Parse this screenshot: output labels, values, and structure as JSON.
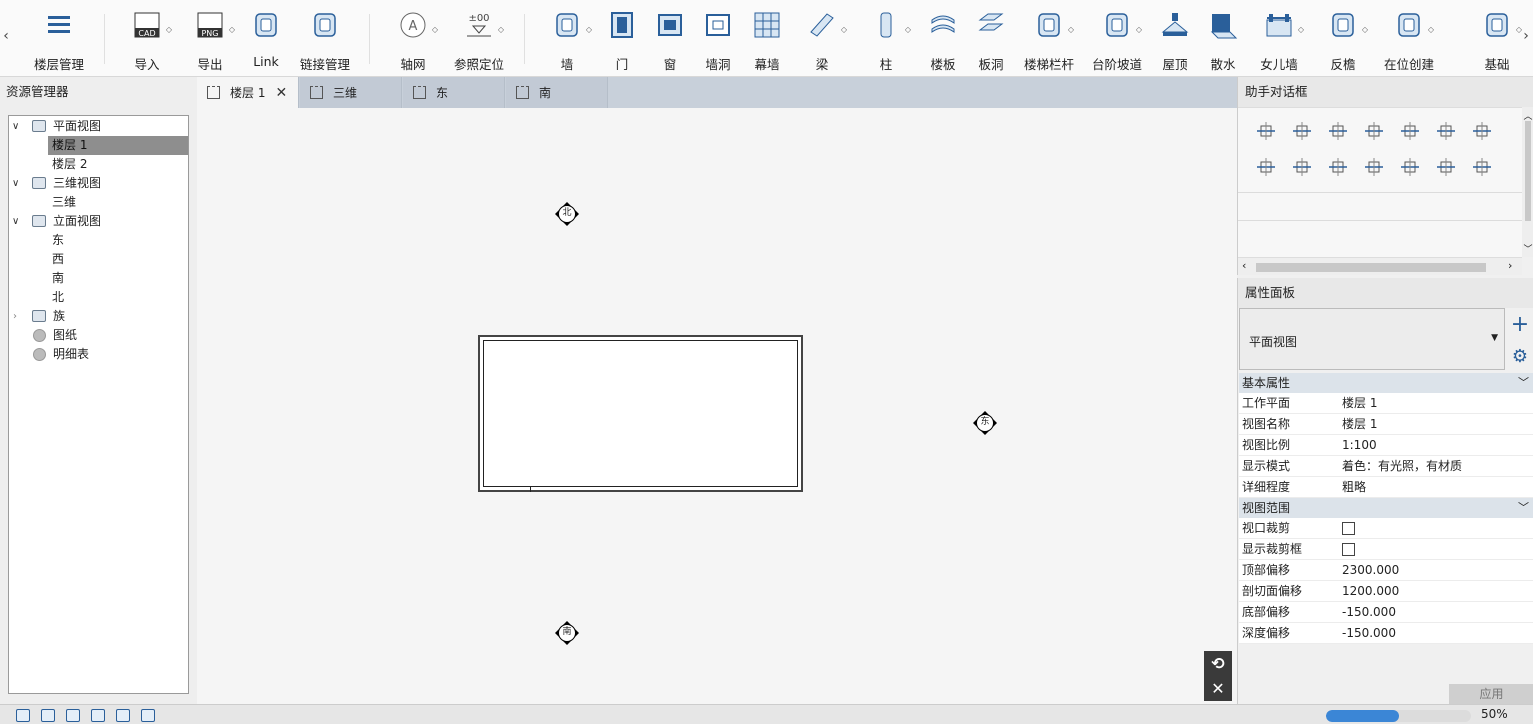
{
  "ribbon": {
    "tools": [
      {
        "id": "floor-mgmt",
        "label": "楼层管理",
        "icon": "floor-levels-icon",
        "dropdown": false
      },
      {
        "id": "import",
        "label": "导入",
        "icon": "cad-import-icon",
        "dropdown": true
      },
      {
        "id": "export",
        "label": "导出",
        "icon": "png-export-icon",
        "dropdown": true
      },
      {
        "id": "link",
        "label": "Link",
        "icon": "link-building-icon",
        "dropdown": false
      },
      {
        "id": "link-mgmt",
        "label": "链接管理",
        "icon": "link-manage-icon",
        "dropdown": false
      },
      {
        "id": "grid",
        "label": "轴网",
        "icon": "axis-grid-icon",
        "dropdown": true
      },
      {
        "id": "ref-level",
        "label": "参照定位",
        "icon": "reference-level-icon",
        "dropdown": true
      },
      {
        "id": "wall",
        "label": "墙",
        "icon": "wall-icon",
        "dropdown": true
      },
      {
        "id": "door",
        "label": "门",
        "icon": "door-icon",
        "dropdown": false
      },
      {
        "id": "window",
        "label": "窗",
        "icon": "window-icon",
        "dropdown": false
      },
      {
        "id": "wall-opening",
        "label": "墙洞",
        "icon": "wall-opening-icon",
        "dropdown": false
      },
      {
        "id": "curtain-wall",
        "label": "幕墙",
        "icon": "curtain-wall-icon",
        "dropdown": false
      },
      {
        "id": "beam",
        "label": "梁",
        "icon": "beam-icon",
        "dropdown": true
      },
      {
        "id": "column",
        "label": "柱",
        "icon": "column-icon",
        "dropdown": true
      },
      {
        "id": "slab",
        "label": "楼板",
        "icon": "slab-icon",
        "dropdown": false
      },
      {
        "id": "slab-opening",
        "label": "板洞",
        "icon": "slab-opening-icon",
        "dropdown": false
      },
      {
        "id": "stair-railing",
        "label": "楼梯栏杆",
        "icon": "stair-railing-icon",
        "dropdown": true
      },
      {
        "id": "step-ramp",
        "label": "台阶坡道",
        "icon": "step-ramp-icon",
        "dropdown": true
      },
      {
        "id": "roof",
        "label": "屋顶",
        "icon": "roof-icon",
        "dropdown": false
      },
      {
        "id": "apron",
        "label": "散水",
        "icon": "apron-icon",
        "dropdown": false
      },
      {
        "id": "parapet",
        "label": "女儿墙",
        "icon": "parapet-icon",
        "dropdown": true
      },
      {
        "id": "eave",
        "label": "反檐",
        "icon": "eave-icon",
        "dropdown": true
      },
      {
        "id": "in-place",
        "label": "在位创建",
        "icon": "in-place-create-icon",
        "dropdown": true
      },
      {
        "id": "foundation",
        "label": "基础",
        "icon": "foundation-icon",
        "dropdown": true
      }
    ]
  },
  "resource_manager": {
    "title": "资源管理器",
    "tree": [
      {
        "label": "平面视图",
        "level": 0,
        "expanded": true,
        "icon": "plan-view-icon"
      },
      {
        "label": "楼层 1",
        "level": 1,
        "selected": true
      },
      {
        "label": "楼层 2",
        "level": 1
      },
      {
        "label": "三维视图",
        "level": 0,
        "expanded": true,
        "icon": "3d-view-icon"
      },
      {
        "label": "三维",
        "level": 1
      },
      {
        "label": "立面视图",
        "level": 0,
        "expanded": true,
        "icon": "elevation-view-icon"
      },
      {
        "label": "东",
        "level": 1
      },
      {
        "label": "西",
        "level": 1
      },
      {
        "label": "南",
        "level": 1
      },
      {
        "label": "北",
        "level": 1
      },
      {
        "label": "族",
        "level": 0,
        "expanded": false,
        "icon": "family-icon"
      },
      {
        "label": "图纸",
        "level": 0,
        "icon": "sheet-icon"
      },
      {
        "label": "明细表",
        "level": 0,
        "icon": "schedule-icon"
      }
    ]
  },
  "tabs": [
    {
      "label": "楼层 1",
      "active": true,
      "closable": true
    },
    {
      "label": "三维",
      "active": false
    },
    {
      "label": "东",
      "active": false
    },
    {
      "label": "南",
      "active": false
    }
  ],
  "canvas": {
    "markers": {
      "north": "北",
      "east": "东",
      "south": "南"
    }
  },
  "assistant": {
    "title": "助手对话框",
    "icons": [
      "move-icon",
      "copy-icon",
      "rotate-icon",
      "align-icon",
      "split-icon",
      "offset-icon",
      "duplicate-icon",
      "trim-icon",
      "extend-icon",
      "array-icon",
      "group-icon",
      "mirror-icon",
      "eraser-icon",
      "paint-icon"
    ]
  },
  "properties": {
    "title": "属性面板",
    "type_selector": "平面视图",
    "sections": [
      {
        "title": "基本属性",
        "rows": [
          {
            "key": "工作平面",
            "value": "楼层 1"
          },
          {
            "key": "视图名称",
            "value": "楼层 1"
          },
          {
            "key": "视图比例",
            "value": "1:100"
          },
          {
            "key": "显示模式",
            "value": "着色：有光照，有材质"
          },
          {
            "key": "详细程度",
            "value": "粗略"
          }
        ]
      },
      {
        "title": "视图范围",
        "rows": [
          {
            "key": "视口裁剪",
            "checkbox": true,
            "checked": false
          },
          {
            "key": "显示裁剪框",
            "checkbox": true,
            "checked": false
          },
          {
            "key": "顶部偏移",
            "value": "2300.000"
          },
          {
            "key": "剖切面偏移",
            "value": "1200.000"
          },
          {
            "key": "底部偏移",
            "value": "-150.000"
          },
          {
            "key": "深度偏移",
            "value": "-150.000"
          }
        ]
      }
    ],
    "apply_label": "应用"
  },
  "status": {
    "zoom": "50%",
    "progress": 0.5,
    "icons": [
      "select-all-icon",
      "filter-icon",
      "filter-select-icon",
      "family-a-icon",
      "family-b-icon",
      "family-c-icon"
    ]
  },
  "colors": {
    "accent": "#2a5f9a",
    "progress": "#3b86d6",
    "tab_bar": "#c8d0da",
    "selected_tree": "#8e8e8e"
  }
}
